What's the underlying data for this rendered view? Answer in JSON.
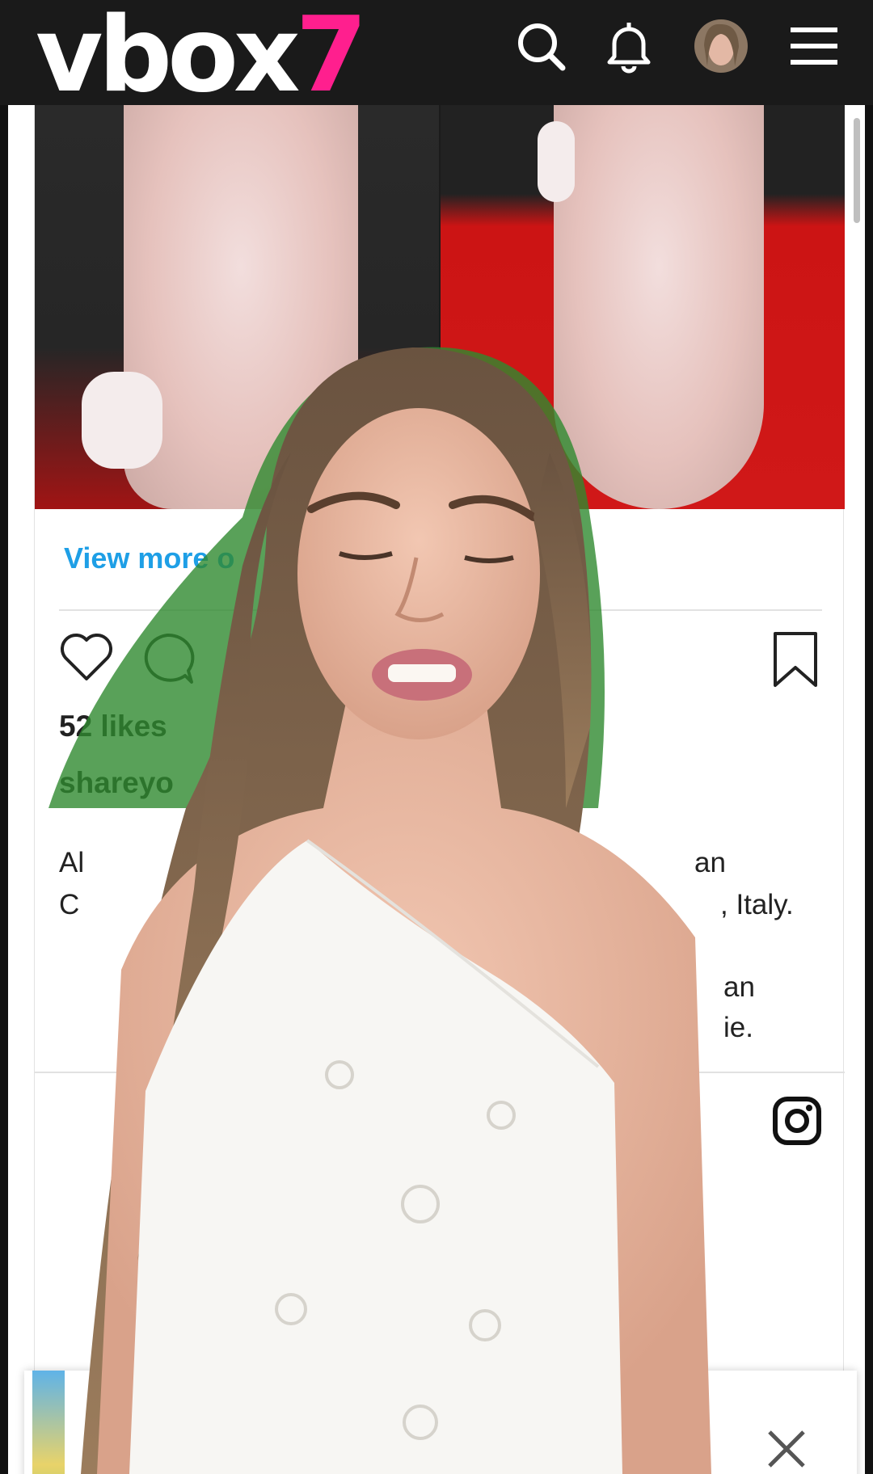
{
  "header": {
    "logo_main": "vbox",
    "logo_accent": "7",
    "icons": [
      "search-icon",
      "bell-icon",
      "avatar",
      "menu-icon"
    ]
  },
  "post": {
    "view_more": "View more o",
    "likes": "52 likes",
    "username": "shareyo",
    "caption_fragments": [
      "Al",
      "an",
      "C",
      ", Italy.",
      "an",
      "ie."
    ]
  },
  "colors": {
    "header_bg": "#1a1a1a",
    "accent": "#ff1f8e",
    "link": "#1e9fe6",
    "carpet": "#d01818"
  }
}
